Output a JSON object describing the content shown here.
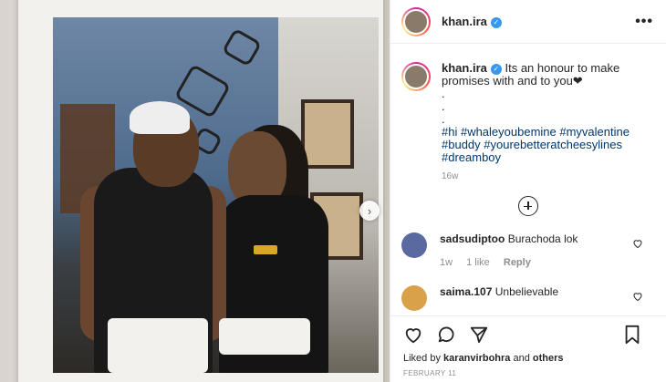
{
  "post": {
    "username": "khan.ira",
    "verified_mark": "✓",
    "more_label": "•••",
    "caption": {
      "text": "Its an honour to make promises with and to you❤",
      "dots": [
        ".",
        ".",
        "."
      ],
      "hashtags": "#hi #whaleyoubemine #myvalentine #buddy #yourebetteratcheesylines #dreamboy"
    },
    "age": "16w"
  },
  "comments": [
    {
      "username": "sadsudiptoo",
      "text": "Burachoda lok",
      "time": "1w",
      "likes": "1 like",
      "reply": "Reply"
    },
    {
      "username": "saima.107",
      "text": "Unbelievable"
    }
  ],
  "footer": {
    "liked_prefix": "Liked by",
    "liked_user": "karanvirbohra",
    "liked_and": "and",
    "liked_others": "others",
    "date": "FEBRUARY 11"
  },
  "media": {
    "next_label": "›"
  }
}
